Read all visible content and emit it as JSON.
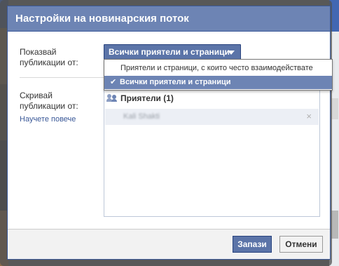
{
  "dialog": {
    "title": "Настройки на новинарския поток"
  },
  "show": {
    "label": "Показвай публикации от:",
    "dropdown_value": "Всички приятели и страници",
    "menu_items": [
      {
        "label": "Приятели и страници, с които често взаимодействате",
        "selected": false
      },
      {
        "label": "Всички приятели и страници",
        "selected": true
      }
    ]
  },
  "hide": {
    "label": "Скривай публикации от:",
    "learn_more": "Научете повече",
    "group_header": "Приятели (1)",
    "hidden_items": [
      {
        "name": "Kali Shakti",
        "remove_symbol": "×"
      }
    ]
  },
  "footer": {
    "save_label": "Запази",
    "cancel_label": "Отмени"
  },
  "icons": {
    "check": "check-icon",
    "caret": "caret-down-icon",
    "friends": "friends-icon",
    "remove": "close-icon"
  }
}
